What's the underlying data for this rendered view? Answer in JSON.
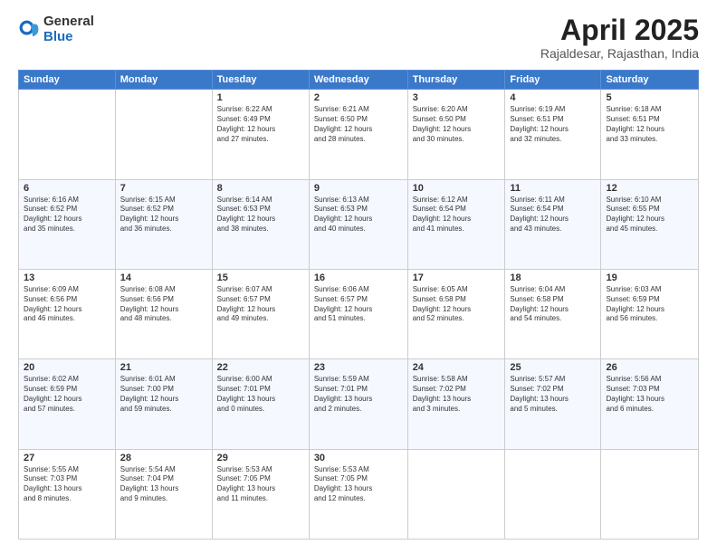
{
  "logo": {
    "general": "General",
    "blue": "Blue"
  },
  "title": "April 2025",
  "location": "Rajaldesar, Rajasthan, India",
  "weekdays": [
    "Sunday",
    "Monday",
    "Tuesday",
    "Wednesday",
    "Thursday",
    "Friday",
    "Saturday"
  ],
  "weeks": [
    [
      {
        "day": "",
        "info": ""
      },
      {
        "day": "",
        "info": ""
      },
      {
        "day": "1",
        "info": "Sunrise: 6:22 AM\nSunset: 6:49 PM\nDaylight: 12 hours\nand 27 minutes."
      },
      {
        "day": "2",
        "info": "Sunrise: 6:21 AM\nSunset: 6:50 PM\nDaylight: 12 hours\nand 28 minutes."
      },
      {
        "day": "3",
        "info": "Sunrise: 6:20 AM\nSunset: 6:50 PM\nDaylight: 12 hours\nand 30 minutes."
      },
      {
        "day": "4",
        "info": "Sunrise: 6:19 AM\nSunset: 6:51 PM\nDaylight: 12 hours\nand 32 minutes."
      },
      {
        "day": "5",
        "info": "Sunrise: 6:18 AM\nSunset: 6:51 PM\nDaylight: 12 hours\nand 33 minutes."
      }
    ],
    [
      {
        "day": "6",
        "info": "Sunrise: 6:16 AM\nSunset: 6:52 PM\nDaylight: 12 hours\nand 35 minutes."
      },
      {
        "day": "7",
        "info": "Sunrise: 6:15 AM\nSunset: 6:52 PM\nDaylight: 12 hours\nand 36 minutes."
      },
      {
        "day": "8",
        "info": "Sunrise: 6:14 AM\nSunset: 6:53 PM\nDaylight: 12 hours\nand 38 minutes."
      },
      {
        "day": "9",
        "info": "Sunrise: 6:13 AM\nSunset: 6:53 PM\nDaylight: 12 hours\nand 40 minutes."
      },
      {
        "day": "10",
        "info": "Sunrise: 6:12 AM\nSunset: 6:54 PM\nDaylight: 12 hours\nand 41 minutes."
      },
      {
        "day": "11",
        "info": "Sunrise: 6:11 AM\nSunset: 6:54 PM\nDaylight: 12 hours\nand 43 minutes."
      },
      {
        "day": "12",
        "info": "Sunrise: 6:10 AM\nSunset: 6:55 PM\nDaylight: 12 hours\nand 45 minutes."
      }
    ],
    [
      {
        "day": "13",
        "info": "Sunrise: 6:09 AM\nSunset: 6:56 PM\nDaylight: 12 hours\nand 46 minutes."
      },
      {
        "day": "14",
        "info": "Sunrise: 6:08 AM\nSunset: 6:56 PM\nDaylight: 12 hours\nand 48 minutes."
      },
      {
        "day": "15",
        "info": "Sunrise: 6:07 AM\nSunset: 6:57 PM\nDaylight: 12 hours\nand 49 minutes."
      },
      {
        "day": "16",
        "info": "Sunrise: 6:06 AM\nSunset: 6:57 PM\nDaylight: 12 hours\nand 51 minutes."
      },
      {
        "day": "17",
        "info": "Sunrise: 6:05 AM\nSunset: 6:58 PM\nDaylight: 12 hours\nand 52 minutes."
      },
      {
        "day": "18",
        "info": "Sunrise: 6:04 AM\nSunset: 6:58 PM\nDaylight: 12 hours\nand 54 minutes."
      },
      {
        "day": "19",
        "info": "Sunrise: 6:03 AM\nSunset: 6:59 PM\nDaylight: 12 hours\nand 56 minutes."
      }
    ],
    [
      {
        "day": "20",
        "info": "Sunrise: 6:02 AM\nSunset: 6:59 PM\nDaylight: 12 hours\nand 57 minutes."
      },
      {
        "day": "21",
        "info": "Sunrise: 6:01 AM\nSunset: 7:00 PM\nDaylight: 12 hours\nand 59 minutes."
      },
      {
        "day": "22",
        "info": "Sunrise: 6:00 AM\nSunset: 7:01 PM\nDaylight: 13 hours\nand 0 minutes."
      },
      {
        "day": "23",
        "info": "Sunrise: 5:59 AM\nSunset: 7:01 PM\nDaylight: 13 hours\nand 2 minutes."
      },
      {
        "day": "24",
        "info": "Sunrise: 5:58 AM\nSunset: 7:02 PM\nDaylight: 13 hours\nand 3 minutes."
      },
      {
        "day": "25",
        "info": "Sunrise: 5:57 AM\nSunset: 7:02 PM\nDaylight: 13 hours\nand 5 minutes."
      },
      {
        "day": "26",
        "info": "Sunrise: 5:56 AM\nSunset: 7:03 PM\nDaylight: 13 hours\nand 6 minutes."
      }
    ],
    [
      {
        "day": "27",
        "info": "Sunrise: 5:55 AM\nSunset: 7:03 PM\nDaylight: 13 hours\nand 8 minutes."
      },
      {
        "day": "28",
        "info": "Sunrise: 5:54 AM\nSunset: 7:04 PM\nDaylight: 13 hours\nand 9 minutes."
      },
      {
        "day": "29",
        "info": "Sunrise: 5:53 AM\nSunset: 7:05 PM\nDaylight: 13 hours\nand 11 minutes."
      },
      {
        "day": "30",
        "info": "Sunrise: 5:53 AM\nSunset: 7:05 PM\nDaylight: 13 hours\nand 12 minutes."
      },
      {
        "day": "",
        "info": ""
      },
      {
        "day": "",
        "info": ""
      },
      {
        "day": "",
        "info": ""
      }
    ]
  ]
}
